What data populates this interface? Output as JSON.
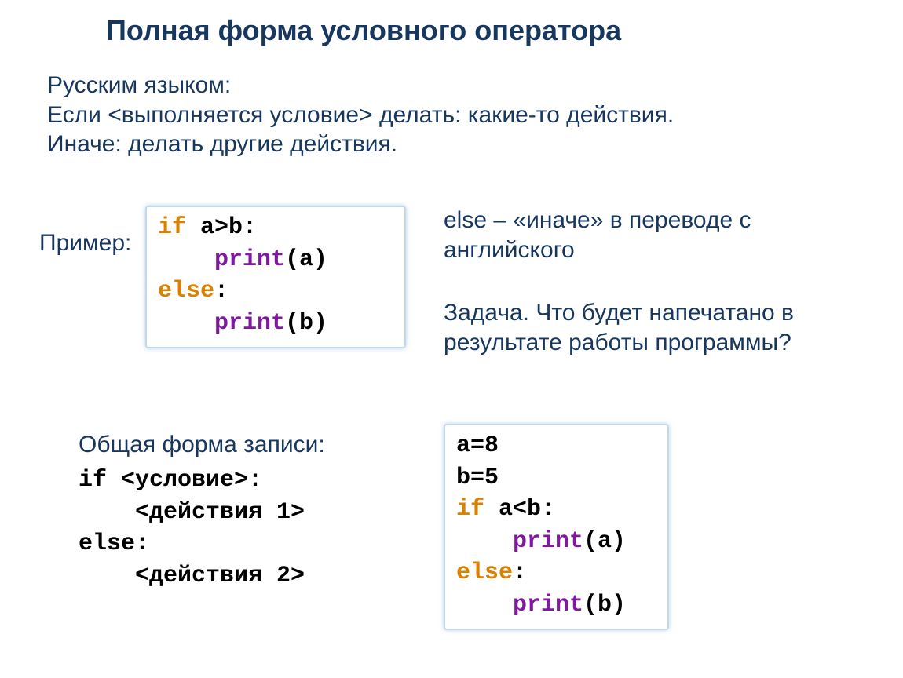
{
  "title": "Полная форма условного оператора",
  "intro": {
    "line1": "Русским языком:",
    "line2": "Если <выполняется условие> делать: какие-то действия.",
    "line3": "Иначе: делать другие действия."
  },
  "example_label": "Пример:",
  "code1": {
    "l1_if": "if",
    "l1_rest": " a>b:",
    "l2_indent": "    ",
    "l2_print": "print",
    "l2_paren": "(a)",
    "l3_else": "else",
    "l3_colon": ":",
    "l4_indent": "    ",
    "l4_print": "print",
    "l4_paren": "(b)"
  },
  "right1": "else – «иначе» в переводе с английского",
  "right2": "Задача. Что будет напечатано в результате работы программы?",
  "general_label": "Общая форма записи:",
  "general": {
    "l1": "if <условие>:",
    "l2": "    <действия 1>",
    "l3": "else:",
    "l4": "    <действия 2>"
  },
  "code2": {
    "l1": "a=8",
    "l2": "b=5",
    "l3_if": "if",
    "l3_rest": " a<b:",
    "l4_indent": "    ",
    "l4_print": "print",
    "l4_paren": "(a)",
    "l5_else": "else",
    "l5_colon": ":",
    "l6_indent": "    ",
    "l6_print": "print",
    "l6_paren": "(b)"
  }
}
